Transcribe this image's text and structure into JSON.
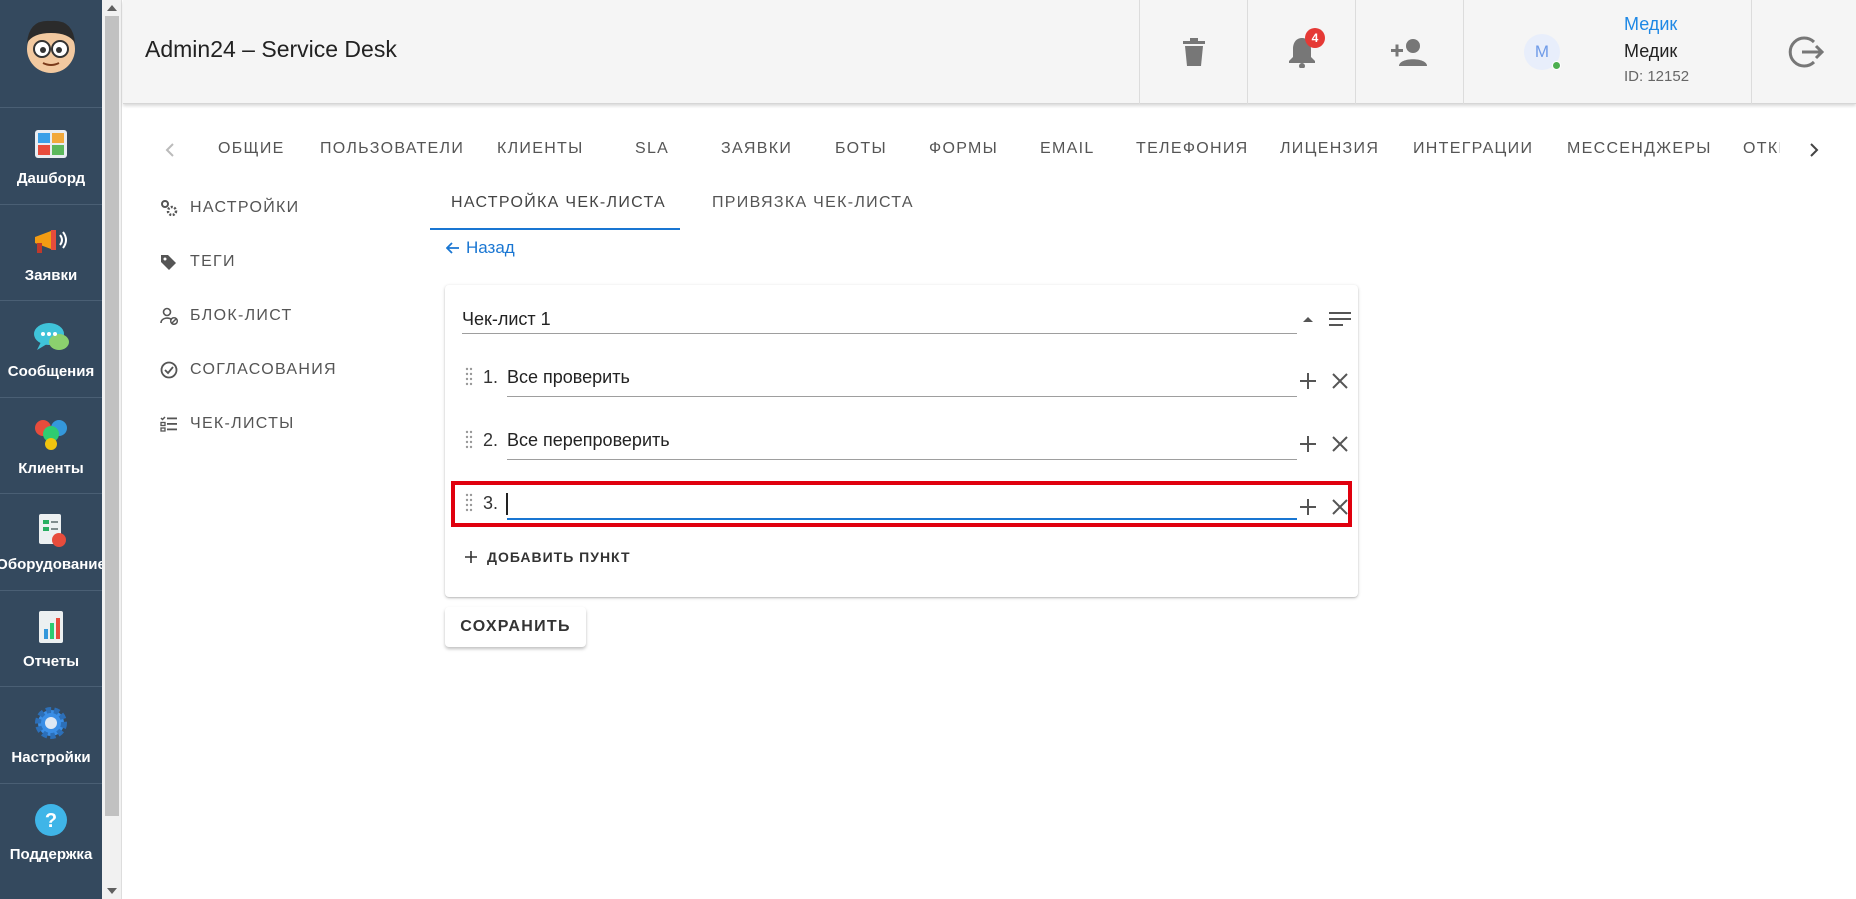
{
  "app": {
    "title": "Admin24 – Service Desk"
  },
  "sidebar": {
    "items": [
      {
        "label": "Дашборд",
        "icon": "dashboard-icon"
      },
      {
        "label": "Заявки",
        "icon": "megaphone-icon"
      },
      {
        "label": "Сообщения",
        "icon": "chat-icon"
      },
      {
        "label": "Клиенты",
        "icon": "clients-icon"
      },
      {
        "label": "Оборудование",
        "icon": "equipment-icon"
      },
      {
        "label": "Отчеты",
        "icon": "report-icon"
      },
      {
        "label": "Настройки",
        "icon": "gear-icon"
      },
      {
        "label": "Поддержка",
        "icon": "help-icon"
      }
    ]
  },
  "header": {
    "notification_count": "4",
    "user": {
      "avatar_letter": "М",
      "name_link": "Медик",
      "name": "Медик",
      "id": "ID: 12152"
    }
  },
  "top_tabs": [
    "ОБЩИЕ",
    "ПОЛЬЗОВАТЕЛИ",
    "КЛИЕНТЫ",
    "SLA",
    "ЗАЯВКИ",
    "БОТЫ",
    "ФОРМЫ",
    "EMAIL",
    "ТЕЛЕФОНИЯ",
    "ЛИЦЕНЗИЯ",
    "ИНТЕГРАЦИИ",
    "МЕССЕНДЖЕРЫ",
    "ОТКР"
  ],
  "submenu": [
    "НАСТРОЙКИ",
    "ТЕГИ",
    "БЛОК-ЛИСТ",
    "СОГЛАСОВАНИЯ",
    "ЧЕК-ЛИСТЫ"
  ],
  "inner_tabs": [
    "НАСТРОЙКА ЧЕК-ЛИСТА",
    "ПРИВЯЗКА ЧЕК-ЛИСТА"
  ],
  "back_label": "Назад",
  "checklist": {
    "title": "Чек-лист 1",
    "items": [
      {
        "num": "1.",
        "text": "Все проверить"
      },
      {
        "num": "2.",
        "text": "Все перепроверить"
      },
      {
        "num": "3.",
        "text": ""
      }
    ],
    "add_label": "ДОБАВИТЬ ПУНКТ"
  },
  "save_label": "СОХРАНИТЬ",
  "colors": {
    "sidebar": "#34495e",
    "accent": "#1976d2",
    "highlight": "#e0000e",
    "badge": "#e53935"
  }
}
